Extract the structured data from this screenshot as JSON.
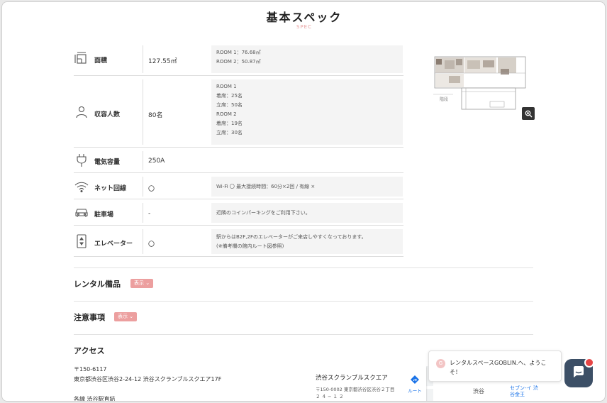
{
  "header": {
    "title": "基本スペック",
    "subtitle": "SPEC"
  },
  "specs": [
    {
      "icon": "floor-area-icon",
      "label": "面積",
      "value": "127.55㎡",
      "notes": [
        "ROOM 1：76.68㎡",
        "ROOM 2：50.87㎡"
      ]
    },
    {
      "icon": "person-icon",
      "label": "収容人数",
      "value": "80名",
      "notes": [
        "ROOM 1",
        "着席：25名",
        "立席：50名",
        "ROOM 2",
        "着席：19名",
        "立席：30名"
      ]
    },
    {
      "icon": "plug-icon",
      "label": "電気容量",
      "value": "250A",
      "notes": []
    },
    {
      "icon": "wifi-icon",
      "label": "ネット回線",
      "value": "〇",
      "notes": [
        "Wi-Fi 〇 最大接続時間：60分×2回 / 有線 ×"
      ]
    },
    {
      "icon": "car-icon",
      "label": "駐車場",
      "value": "-",
      "notes": [
        "近隣のコインパーキングをご利用下さい。"
      ]
    },
    {
      "icon": "elevator-icon",
      "label": "エレベーター",
      "value": "〇",
      "notes": [
        "駅からはB2F,2Fのエレベーターがご来店しやすくなっております。",
        "(※備考欄の館内ルート図参照)"
      ]
    }
  ],
  "floorplan": {
    "caption": "階段",
    "zoom_icon": "zoom-in-icon"
  },
  "rental": {
    "heading": "レンタル備品",
    "toggle": "表示 ⌄"
  },
  "caution": {
    "heading": "注意事項",
    "toggle": "表示 ⌄"
  },
  "access": {
    "heading": "アクセス",
    "postal": "〒150-6117",
    "address": "東京都渋谷区渋谷2-24-12 渋谷スクランブルスクエア17F",
    "station": "各線 渋谷駅直結"
  },
  "map": {
    "place_name": "渋谷スクランブルスクエア",
    "address_line1": "〒150-0002 東京都渋谷区渋谷２丁目",
    "address_line2": "２４−１２",
    "route_label": "ルート",
    "area_label": "渋谷",
    "store_label": "セブン-イ 渋谷金王"
  },
  "chat": {
    "avatar_letter": "G",
    "message_line1": "レンタルスペースGOBLIN.へ、ようこ",
    "message_line2": "そ！"
  },
  "colors": {
    "accent": "#ec9f9f",
    "chat_button": "#3c4f66",
    "badge": "#e64545"
  }
}
